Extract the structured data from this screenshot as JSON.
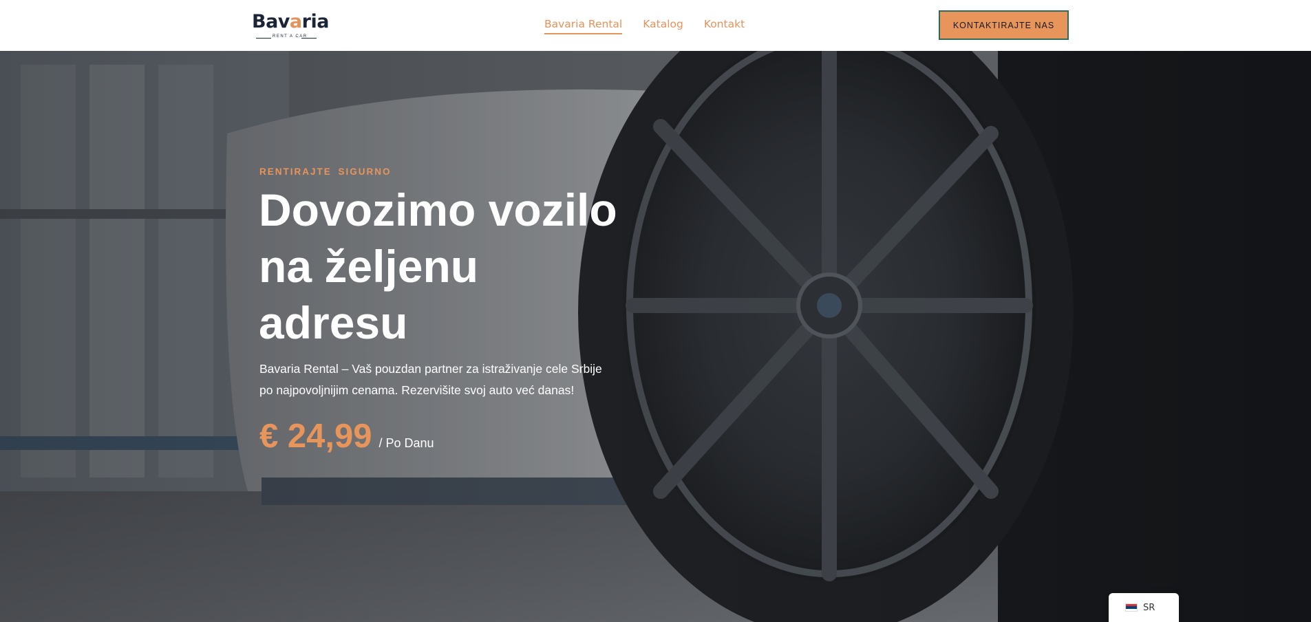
{
  "header": {
    "logo": {
      "word_left": "Bav",
      "word_mid": "a",
      "word_right": "ria",
      "tagline": "RENT A CAR"
    },
    "nav": [
      {
        "label": "Bavaria Rental",
        "active": true
      },
      {
        "label": "Katalog",
        "active": false
      },
      {
        "label": "Kontakt",
        "active": false
      }
    ],
    "cta_label": "KONTAKTIRAJTE NAS"
  },
  "hero": {
    "eyebrow": "RENTIRAJTE  SIGURNO",
    "headline_lines": [
      "Dovozimo vozilo",
      "na željenu",
      "adresu"
    ],
    "description_lines": [
      "Bavaria Rental – Vaš pouzdan partner za istraživanje cele Srbije",
      "po najpovoljnijim cenama. Rezervišite svoj auto već danas!"
    ],
    "price": {
      "amount": "€ 24,99",
      "per": "/ Po Danu"
    },
    "background_image": "car-wheel-photo"
  },
  "language_switcher": {
    "code": "SR",
    "flag_icon": "serbia-flag-icon"
  },
  "colors": {
    "accent": "#e8955c",
    "brand_dark": "#1c2438",
    "cta_border": "#2e6b5a"
  }
}
